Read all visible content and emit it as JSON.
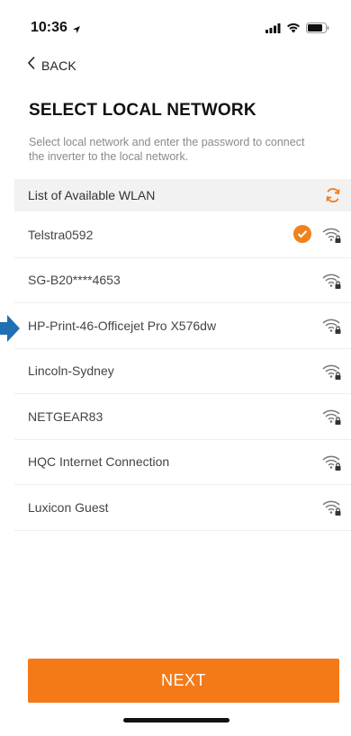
{
  "status_bar": {
    "time": "10:36",
    "icons": [
      "location-arrow-icon",
      "cellular-signal-icon",
      "wifi-status-icon",
      "battery-icon"
    ]
  },
  "nav": {
    "back_label": "BACK",
    "back_icon": "chevron-left-icon"
  },
  "page": {
    "title": "SELECT LOCAL NETWORK",
    "description": "Select local network and enter the password to connect the inverter to the local network."
  },
  "list": {
    "header": "List of Available WLAN",
    "refresh_icon": "refresh-icon",
    "networks": [
      {
        "name": "Telstra0592",
        "selected": true
      },
      {
        "name": "SG-B20****4653",
        "selected": false
      },
      {
        "name": "HP-Print-46-Officejet Pro X576dw",
        "selected": false
      },
      {
        "name": "Lincoln-Sydney",
        "selected": false
      },
      {
        "name": "NETGEAR83",
        "selected": false
      },
      {
        "name": "HQC Internet Connection",
        "selected": false
      },
      {
        "name": "Luxicon Guest",
        "selected": false
      }
    ]
  },
  "footer": {
    "next_label": "NEXT"
  },
  "colors": {
    "accent": "#f47a18",
    "check": "#f0821e",
    "marker_arrow": "#1f6fb5"
  }
}
